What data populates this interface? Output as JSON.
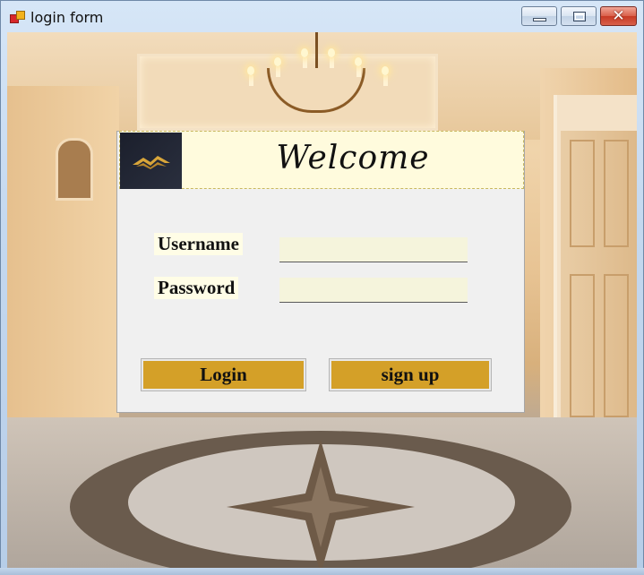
{
  "window": {
    "title": "login form",
    "controls": {
      "minimize_icon": "minimize-icon",
      "maximize_icon": "maximize-icon",
      "close_icon": "close-icon",
      "close_glyph": "✕"
    }
  },
  "background": {
    "description_icon": "hotel-lobby-image"
  },
  "form": {
    "welcome": "Welcome",
    "logo_icon": "house-roof-logo-icon",
    "username_label": "Username",
    "password_label": "Password",
    "username_value": "",
    "password_value": "",
    "login_label": "Login",
    "signup_label": "sign up"
  },
  "colors": {
    "button_fill": "#d4a028",
    "header_fill": "#fffbdd",
    "field_fill": "#f5f4dc",
    "panel_fill": "#f0f0f0",
    "logo_bg": "#1b1f2c",
    "logo_gold": "#d9a63a"
  }
}
